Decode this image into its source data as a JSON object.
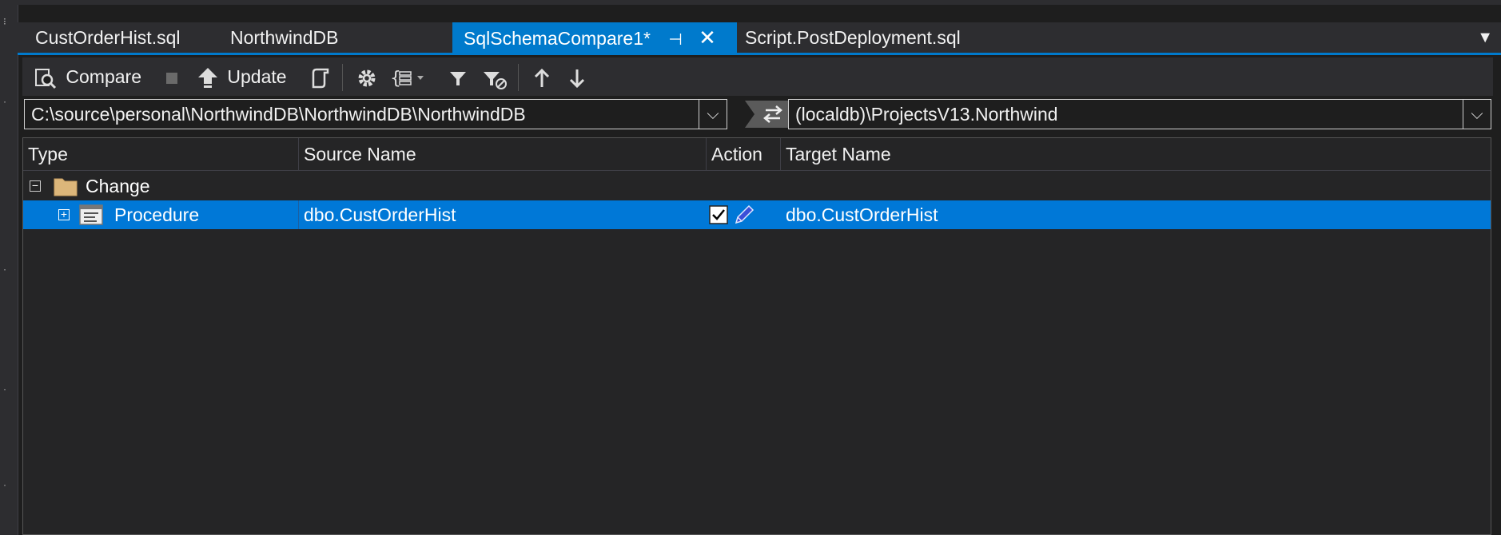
{
  "tabs": [
    {
      "label": "CustOrderHist.sql"
    },
    {
      "label": "NorthwindDB"
    },
    {
      "label": "SqlSchemaCompare1*"
    },
    {
      "label": "Script.PostDeployment.sql"
    }
  ],
  "toolbar": {
    "compare_label": "Compare",
    "update_label": "Update"
  },
  "connection": {
    "source": "C:\\source\\personal\\NorthwindDB\\NorthwindDB\\NorthwindDB",
    "target": "(localdb)\\ProjectsV13.Northwind"
  },
  "grid": {
    "columns": [
      "Type",
      "Source Name",
      "Action",
      "Target Name"
    ],
    "group": {
      "label": "Change"
    },
    "rows": [
      {
        "type": "Procedure",
        "source": "dbo.CustOrderHist",
        "target": "dbo.CustOrderHist"
      }
    ]
  },
  "colors": {
    "accent": "#007acc",
    "selection": "#0078d7",
    "background": "#1e1e1e"
  }
}
